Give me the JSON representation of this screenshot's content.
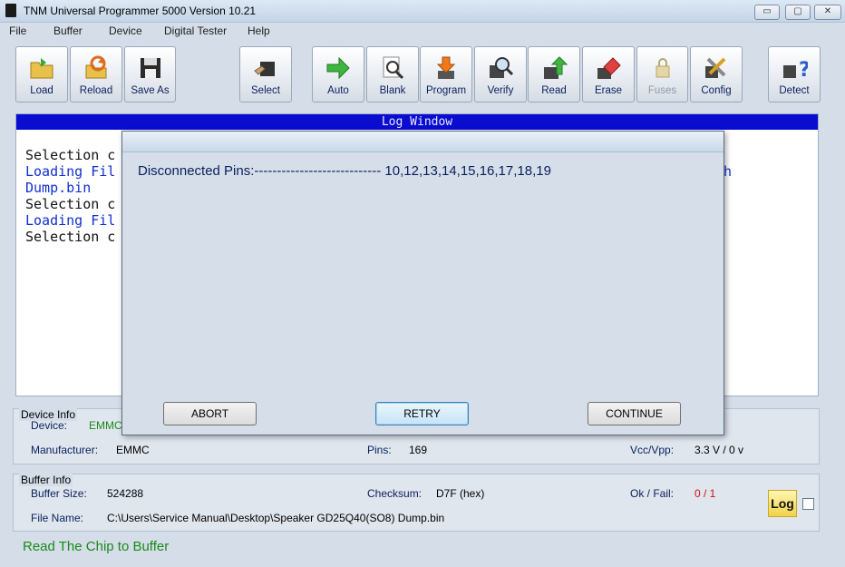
{
  "window": {
    "title": "TNM  Universal Programmer 5000   Version 10.21",
    "min": "▭",
    "max": "▢",
    "close": "✕"
  },
  "menu": [
    "File",
    "Buffer",
    "Device",
    "Digital Tester",
    "Help"
  ],
  "toolbar": {
    "load": "Load",
    "reload": "Reload",
    "save_as": "Save As",
    "select": "Select",
    "auto": "Auto",
    "blank": "Blank",
    "program": "Program",
    "verify": "Verify",
    "read": "Read",
    "erase": "Erase",
    "fuses": "Fuses",
    "config": "Config",
    "detect": "Detect"
  },
  "log": {
    "header": "Log Window",
    "lines": [
      "Selection c",
      "Loading Fil",
      "Dump.bin",
      "Selection c",
      "Loading Fil",
      "Selection c"
    ],
    "fragment": "h"
  },
  "device_info": {
    "title": "Device Info",
    "device_label": "Device:",
    "device_value": "EMMC",
    "manufacturer_label": "Manufacturer:",
    "manufacturer_value": "EMMC",
    "pins_label": "Pins:",
    "pins_value": "169",
    "vcc_label": "Vcc/Vpp:",
    "vcc_value": "3.3 V / 0 v"
  },
  "buffer_info": {
    "title": "Buffer Info",
    "size_label": "Buffer Size:",
    "size_value": "524288",
    "checksum_label": "Checksum:",
    "checksum_value": "D7F (hex)",
    "okfail_label": "Ok / Fail:",
    "okfail_value": "0 / 1",
    "file_label": "File Name:",
    "file_value": "C:\\Users\\Service Manual\\Desktop\\Speaker GD25Q40(SO8) Dump.bin"
  },
  "status": "Read The Chip to Buffer",
  "log_badge": "Log",
  "dialog": {
    "message": "Disconnected Pins:---------------------------- 10,12,13,14,15,16,17,18,19",
    "abort": "ABORT",
    "retry": "RETRY",
    "continue": "CONTINUE"
  },
  "colors": {
    "log_header": "#0a0cd0",
    "status_green": "#1a8a1a",
    "fail_red": "#d01010"
  }
}
